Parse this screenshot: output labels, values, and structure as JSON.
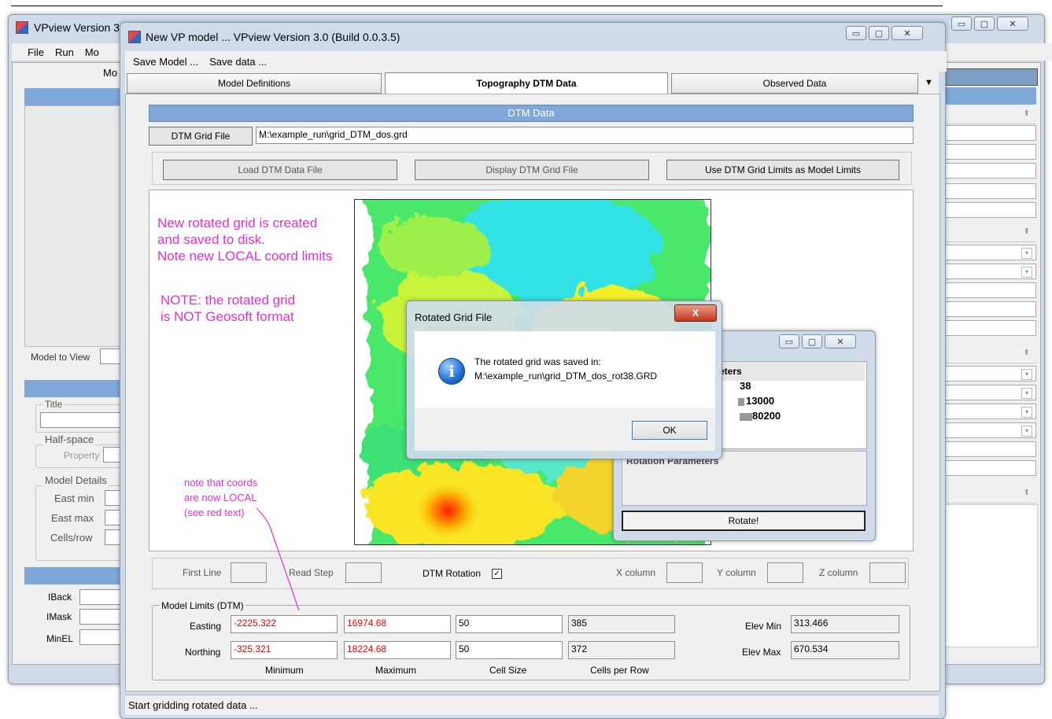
{
  "back_window": {
    "title": "VPview Version 3",
    "menu": [
      "File",
      "Run",
      "Mo"
    ],
    "submenu_fragment": "Mo",
    "model_to_view_label": "Model to View",
    "title_group": "Title",
    "halfspace_group": "Half-space",
    "property_label": "Property",
    "model_details_group": "Model Details",
    "east_min_label": "East min",
    "east_max_label": "East max",
    "cells_row_label": "Cells/row",
    "iback_label": "IBack",
    "imask_label": "IMask",
    "minel_label": "MinEL"
  },
  "main_window": {
    "title": "New VP model ... VPview Version 3.0 (Build 0.0.3.5)",
    "menu": [
      "Save Model ...",
      "Save data ..."
    ],
    "tabs": [
      {
        "label": "Model Definitions",
        "active": false
      },
      {
        "label": "Topography DTM Data",
        "active": true
      },
      {
        "label": "Observed Data",
        "active": false
      }
    ],
    "dtm_header": "DTM Data",
    "dtm_grid_file_button": "DTM Grid File",
    "dtm_grid_path": "M:\\example_run\\grid_DTM_dos.grd",
    "buttons": {
      "load": "Load DTM Data File",
      "display": "Display DTM Grid File",
      "use_limits": "Use DTM Grid Limits as Model Limits"
    },
    "params": {
      "first_line": "First Line",
      "read_step": "Read Step",
      "dtm_rotation": "DTM Rotation",
      "x_column": "X column",
      "y_column": "Y column",
      "z_column": "Z column"
    },
    "model_limits": {
      "group_title": "Model Limits (DTM)",
      "easting_label": "Easting",
      "northing_label": "Northing",
      "easting": {
        "min": "-2225.322",
        "max": "16974.68",
        "cell": "50",
        "cells": "385"
      },
      "northing": {
        "min": "-325.321",
        "max": "18224.68",
        "cell": "50",
        "cells": "372"
      },
      "col_minimum": "Minimum",
      "col_maximum": "Maximum",
      "col_cell_size": "Cell Size",
      "col_cells_per_row": "Cells per Row",
      "elev_min_label": "Elev Min",
      "elev_max_label": "Elev Max",
      "elev_min": "313.466",
      "elev_max": "670.534"
    },
    "status": "Start gridding rotated data ..."
  },
  "annotations": {
    "a1": "New rotated grid is created\nand saved to disk.\nNote new LOCAL coord limits",
    "a2": "NOTE: the rotated grid\nis NOT Geosoft format",
    "a3": "note that coords\nare now LOCAL\n(see red text)"
  },
  "rotation_window": {
    "params_header": "eters",
    "values": [
      "38",
      "13000",
      "80200"
    ],
    "parameters_label": "Rotation Parameters",
    "rotate_button": "Rotate!"
  },
  "message_box": {
    "title": "Rotated Grid File",
    "line1": "The rotated grid was saved in:",
    "line2": "M:\\example_run\\grid_DTM_dos_rot38.GRD",
    "ok": "OK",
    "close_glyph": "X"
  },
  "icons": {
    "info": "info-icon",
    "app": "app-icon"
  },
  "colors": {
    "annotation": "#e62fd4",
    "red_value": "#ee0000",
    "header_blue": "#7fa7d8"
  }
}
